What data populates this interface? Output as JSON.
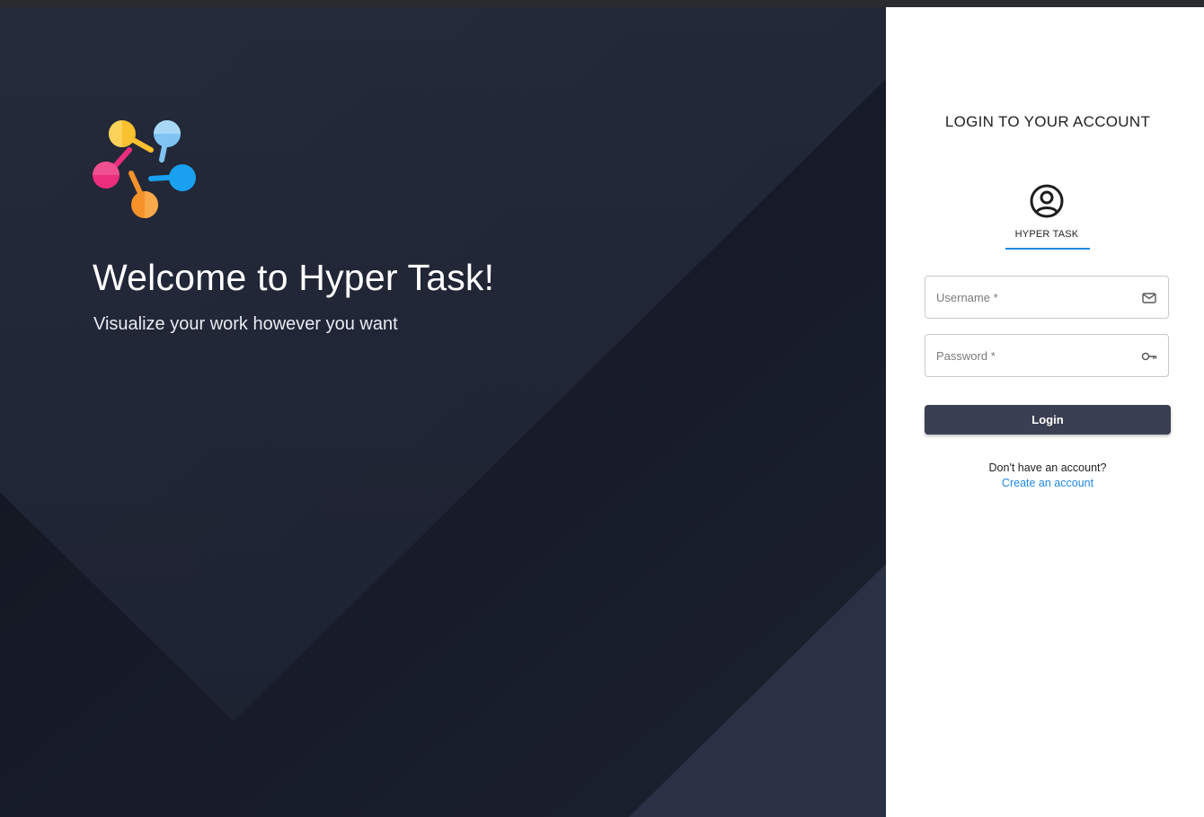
{
  "hero": {
    "title": "Welcome to Hyper Task!",
    "subtitle": "Visualize your work however you want",
    "background_color": "#1f2434",
    "logo_icon": "pentagon-network-logo"
  },
  "login": {
    "heading": "LOGIN TO YOUR ACCOUNT",
    "tab_label": "HYPER TASK",
    "tab_icon": "user-circle-icon",
    "username_placeholder": "Username *",
    "username_icon": "mail-icon",
    "password_placeholder": "Password *",
    "password_icon": "key-icon",
    "button_label": "Login",
    "signup_prompt": "Don't have an account?",
    "signup_link": "Create an account"
  },
  "colors": {
    "accent": "#1e88e5",
    "button": "#3a3f51",
    "logo_yellow": "#f9c02f",
    "logo_lightblue": "#7fc4f2",
    "logo_blue": "#19a0f0",
    "logo_orange": "#f5922a",
    "logo_pink": "#ec2d7c"
  }
}
